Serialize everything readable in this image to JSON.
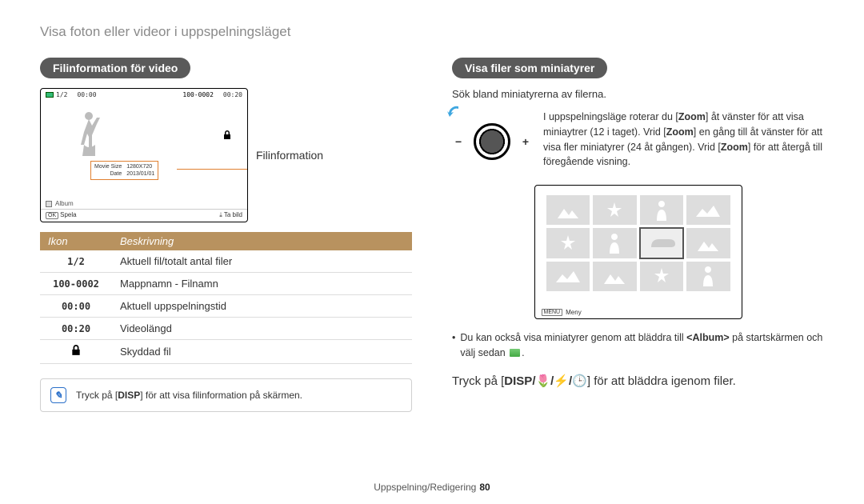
{
  "page_title": "Visa foton eller videor i uppspelningsläget",
  "footer": {
    "section": "Uppspelning/Redigering",
    "page": "80"
  },
  "left": {
    "heading": "Filinformation för video",
    "screen": {
      "counter": "1/2",
      "time_elapsed": "00:00",
      "folder_file": "100-0002",
      "duration": "00:20",
      "info_k1": "Movie Size",
      "info_v1": "1280X720",
      "info_k2": "Date",
      "info_v2": "2013/01/01",
      "album_label": "Album",
      "ok_label": "OK",
      "play_label": "Spela",
      "capture_label": "Ta bild"
    },
    "callout": "Filinformation",
    "table": {
      "th_icon": "Ikon",
      "th_desc": "Beskrivning",
      "rows": [
        {
          "icon": "1/2",
          "desc": "Aktuell fil/totalt antal filer"
        },
        {
          "icon": "100-0002",
          "desc": "Mappnamn - Filnamn"
        },
        {
          "icon": "00:00",
          "desc": "Aktuell uppspelningstid"
        },
        {
          "icon": "00:20",
          "desc": "Videolängd"
        },
        {
          "icon": "lock",
          "desc": "Skyddad fil"
        }
      ]
    },
    "tip": {
      "pre": "Tryck på [",
      "disp": "DISP",
      "post": "] för att visa filinformation på skärmen."
    }
  },
  "right": {
    "heading": "Visa filer som miniatyrer",
    "sub": "Sök bland miniatyrerna av filerna.",
    "zoom_text_parts": {
      "p1": "I uppspelningsläge roterar du [",
      "z1": "Zoom",
      "p2": "] åt vänster för att visa miniaytrer (12 i taget). Vrid [",
      "z2": "Zoom",
      "p3": "] en gång till åt vänster för att visa fler miniatyrer (24 åt gången). Vrid [",
      "z3": "Zoom",
      "p4": "] för att återgå till föregående visning."
    },
    "thumb": {
      "menu_tag": "MENU",
      "menu_label": "Meny"
    },
    "note": {
      "pre": "Du kan också visa miniatyrer genom att bläddra till ",
      "album": "<Album>",
      "mid": " på startskärmen och välj sedan ",
      "post": "."
    },
    "instruction": {
      "pre": "Tryck på [",
      "disp": "DISP",
      "post": "] för att bläddra igenom filer."
    }
  }
}
